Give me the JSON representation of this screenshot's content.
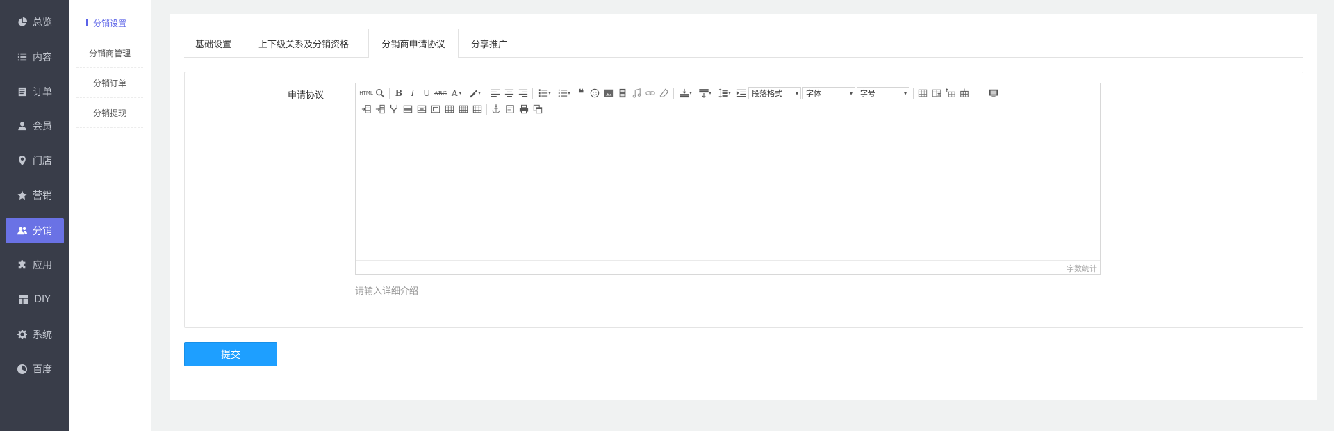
{
  "sidebar": {
    "items": [
      {
        "label": "总览",
        "icon": "pie-chart-icon"
      },
      {
        "label": "内容",
        "icon": "list-icon"
      },
      {
        "label": "订单",
        "icon": "order-icon"
      },
      {
        "label": "会员",
        "icon": "user-icon"
      },
      {
        "label": "门店",
        "icon": "location-icon"
      },
      {
        "label": "营销",
        "icon": "star-icon"
      },
      {
        "label": "分销",
        "icon": "users-icon",
        "active": true
      },
      {
        "label": "应用",
        "icon": "puzzle-icon"
      },
      {
        "label": "DIY",
        "icon": "layout-icon"
      },
      {
        "label": "系统",
        "icon": "gear-icon"
      },
      {
        "label": "百度",
        "icon": "baidu-icon"
      }
    ]
  },
  "submenu": {
    "items": [
      {
        "label": "分销设置",
        "active": true
      },
      {
        "label": "分销商管理"
      },
      {
        "label": "分销订单"
      },
      {
        "label": "分销提现"
      }
    ]
  },
  "tabs": [
    {
      "label": "基础设置"
    },
    {
      "label": "上下级关系及分销资格"
    },
    {
      "label": "分销商申请协议",
      "active": true
    },
    {
      "label": "分享推广"
    }
  ],
  "form": {
    "label": "申请协议",
    "hint": "请输入详细介绍",
    "submit": "提交"
  },
  "editor": {
    "paragraph_select": "段落格式",
    "font_select": "字体",
    "size_select": "字号",
    "wordcount_label": "字数统计",
    "html_label": "HTML"
  },
  "colors": {
    "sidebar_bg": "#393d49",
    "active_nav": "#6a72e5",
    "submenu_active": "#5b63e8",
    "submit_bg": "#1e9fff"
  }
}
